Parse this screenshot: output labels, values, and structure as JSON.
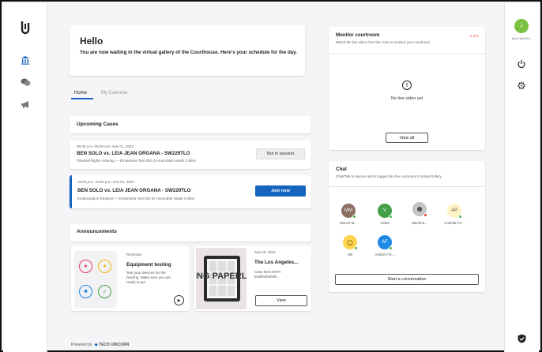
{
  "app": {
    "footer_powered": "Powered by",
    "footer_brand": "TECH UNICORN"
  },
  "sidebar": {
    "items": [
      {
        "icon": "logo-icon"
      },
      {
        "icon": "courthouse-icon",
        "active": true
      },
      {
        "icon": "chat-bubbles-icon"
      },
      {
        "icon": "megaphone-icon"
      }
    ]
  },
  "user": {
    "initial": "J",
    "name": "jdoe1@6048...",
    "accent": "#7cc242"
  },
  "greeting": {
    "title": "Hello",
    "subtitle": "You are now waiting in the virtual gallery of the Courthouse. Here's your schedule for the day."
  },
  "tabs": [
    {
      "label": "Home",
      "active": true
    },
    {
      "label": "My Calendar",
      "active": false
    }
  ],
  "upcoming": {
    "title": "Upcoming Cases",
    "cases": [
      {
        "time": "09:00 a.m.-09:30 a.m. Nov 01, 2022",
        "title": "BEN SOLO vs. LEIA JEAN ORGANA - SW229TLO",
        "detail": "Parental Rights Hearing — Ermenteria Test 002 ID Honorable Sarah Collins",
        "action": "Not in session",
        "active": false
      },
      {
        "time": "10:00 p.m.-11:00 p.m. Nov 01, 2022",
        "title": "BEN SOLO vs. LEIA JEAN ORGANA - SW229TLO",
        "detail": "Emancipation Request — Ermenteria Test 002 ID Honorable Sarah Collins",
        "action": "Join now",
        "active": true
      }
    ]
  },
  "announcements": {
    "title": "Announcements",
    "items": [
      {
        "tag": "Reminder",
        "title": "Equipment testing",
        "body": "Test your devices for the hearing. Make sure you are ready to go!",
        "image_text": ""
      },
      {
        "tag": "Sep 29, 2022",
        "title": "The Los Angeles...",
        "body": "Case lines NOTI lesdfesfesfeifs...",
        "image_text": "ING PAPERLES",
        "button": "View"
      }
    ]
  },
  "monitor": {
    "title": "Monitor courtroom",
    "subtitle": "Watch the live video from the room to monitor your courtroom",
    "badge": "1 of 1",
    "empty_text": "No live video yet",
    "view_all": "View all"
  },
  "chat": {
    "title": "Chat",
    "subtitle": "Chat/Talk to anyone who's logged into the courtroom's Virtual Gallery",
    "people": [
      {
        "initials": "MM",
        "name": "Marcel M...",
        "bg": "#8d6e63",
        "status": "#4caf50"
      },
      {
        "initials": "V",
        "name": "Vahid",
        "bg": "#43a047",
        "status": "#4caf50"
      },
      {
        "initials": "",
        "name": "Marisha...",
        "bg": "#c4c4c4",
        "status": "#e53935",
        "emoji": "face"
      },
      {
        "initials": "AP",
        "name": "Anahita Pri...",
        "bg": "#fff3c4",
        "status": "#4caf50",
        "dark": true
      },
      {
        "initials": "",
        "name": "Hiti",
        "bg": "#ffd54f",
        "status": "#4caf50",
        "emoji": "smile"
      },
      {
        "initials": "AF",
        "name": "Ashish F.E...",
        "bg": "#1e88e5",
        "status": "#4caf50"
      }
    ],
    "start_label": "Start a conversation"
  },
  "colors": {
    "primary": "#1565c0",
    "active_border": "#1565c0"
  }
}
